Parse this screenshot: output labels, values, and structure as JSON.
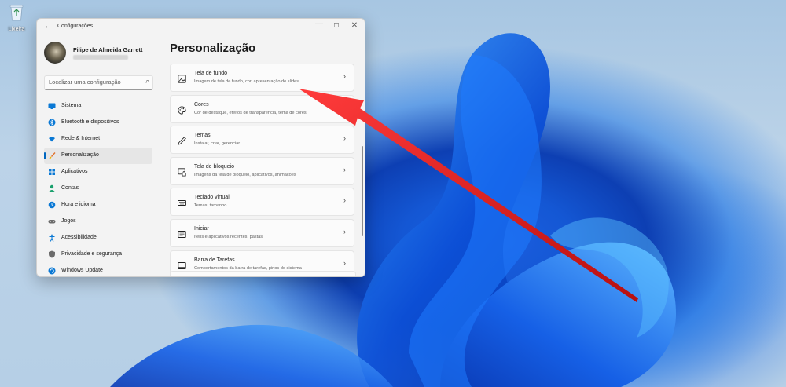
{
  "desktop": {
    "recycle_bin_label": "Lixeira"
  },
  "window": {
    "title": "Configurações",
    "back": "←",
    "minimize": "—",
    "maximize": "☐",
    "close": "✕"
  },
  "user": {
    "name": "Filipe de Almeida Garrett"
  },
  "search": {
    "placeholder": "Localizar uma configuração",
    "icon": "search-icon"
  },
  "sidebar": {
    "items": [
      {
        "label": "Sistema",
        "icon": "monitor-icon",
        "color": "#0a78d4"
      },
      {
        "label": "Bluetooth e dispositivos",
        "icon": "bluetooth-icon",
        "color": "#0a78d4"
      },
      {
        "label": "Rede & Internet",
        "icon": "wifi-icon",
        "color": "#0a78d4"
      },
      {
        "label": "Personalização",
        "icon": "brush-icon",
        "color": "#e0702b",
        "active": true
      },
      {
        "label": "Aplicativos",
        "icon": "apps-icon",
        "color": "#0a78d4"
      },
      {
        "label": "Contas",
        "icon": "person-icon",
        "color": "#1aa06d"
      },
      {
        "label": "Hora e idioma",
        "icon": "globe-clock-icon",
        "color": "#0a78d4"
      },
      {
        "label": "Jogos",
        "icon": "gamepad-icon",
        "color": "#6b6b6b"
      },
      {
        "label": "Acessibilidade",
        "icon": "accessibility-icon",
        "color": "#0a78d4"
      },
      {
        "label": "Privacidade e segurança",
        "icon": "shield-icon",
        "color": "#6b6b6b"
      },
      {
        "label": "Windows Update",
        "icon": "update-icon",
        "color": "#0a78d4"
      }
    ]
  },
  "main": {
    "title": "Personalização",
    "cards": [
      {
        "title": "Tela de fundo",
        "desc": "Imagem de tela de fundo, cor, apresentação de slides",
        "icon": "image-icon"
      },
      {
        "title": "Cores",
        "desc": "Cor de destaque, efeitos de transparência, tema de cores",
        "icon": "palette-icon"
      },
      {
        "title": "Temas",
        "desc": "Instalar, criar, gerenciar",
        "icon": "pen-icon"
      },
      {
        "title": "Tela de bloqueio",
        "desc": "Imagens da tela de bloqueio, aplicativos, animações",
        "icon": "lock-screen-icon"
      },
      {
        "title": "Teclado virtual",
        "desc": "Temas, tamanho",
        "icon": "keyboard-icon"
      },
      {
        "title": "Iniciar",
        "desc": "Itens e aplicativos recentes, pastas",
        "icon": "start-icon"
      },
      {
        "title": "Barra de Tarefas",
        "desc": "Comportamentos da barra de tarefas, pinos do sistema",
        "icon": "taskbar-icon"
      }
    ]
  },
  "colors": {
    "accent": "#0067c0",
    "arrow": "#d61f1f"
  }
}
